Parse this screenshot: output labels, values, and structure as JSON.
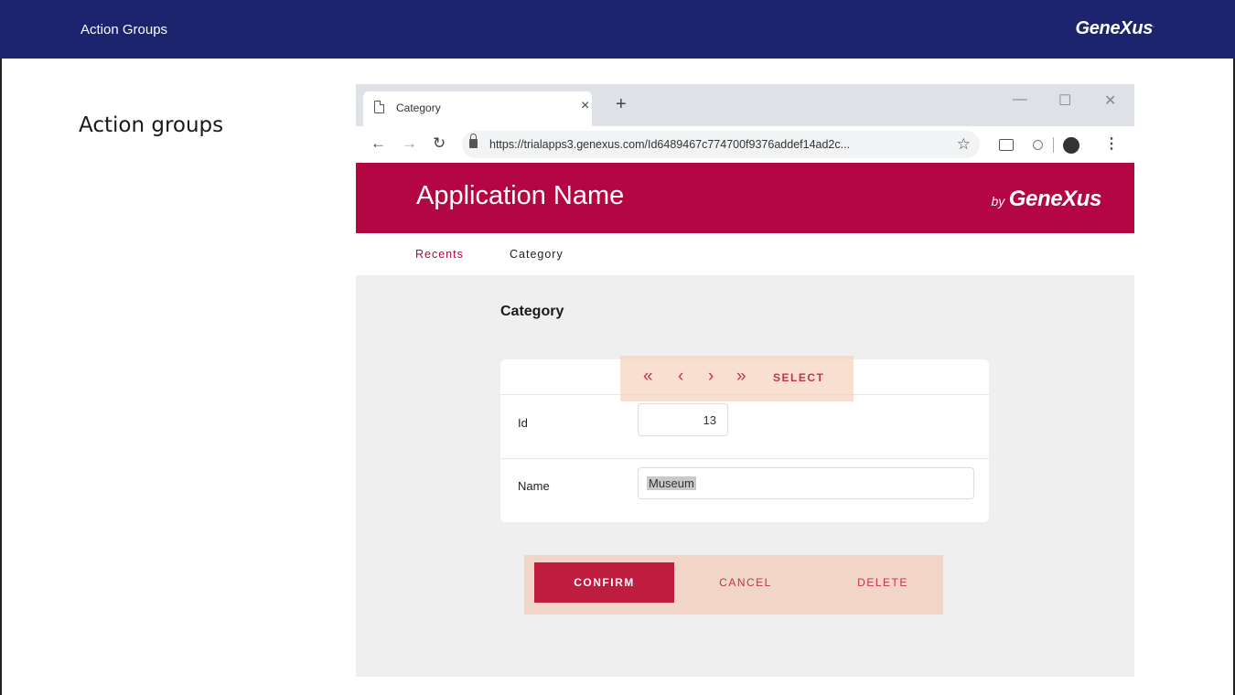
{
  "slide": {
    "section_title": "Action Groups",
    "brand": "GeneXus",
    "heading": "Action groups"
  },
  "browser": {
    "tab_title": "Category",
    "tab_close": "×",
    "new_tab": "+",
    "window_controls": {
      "minimize": "—",
      "maximize": "☐",
      "close": "✕"
    },
    "url": "https://trialapps3.genexus.com/Id6489467c774700f9376addef14ad2c...",
    "icons": [
      "page-icon",
      "back-icon",
      "forward-icon",
      "reload-icon",
      "lock-icon",
      "star-icon",
      "cast-icon",
      "extension-icon",
      "avatar",
      "menu-icon"
    ]
  },
  "app": {
    "title": "Application Name",
    "brand_by": "by",
    "brand_name": "GeneXus",
    "nav": {
      "recents": "Recents",
      "category": "Category"
    },
    "content_title": "Category",
    "navigation": {
      "first": "«",
      "previous": "‹",
      "next": "›",
      "last": "»",
      "select": "SELECT"
    },
    "fields": {
      "id_label": "Id",
      "id_value": "13",
      "name_label": "Name",
      "name_value": "Museum"
    },
    "actions": {
      "confirm": "CONFIRM",
      "cancel": "CANCEL",
      "delete": "DELETE"
    }
  },
  "colors": {
    "slide_header": "#1b246c",
    "app_header": "#b30642",
    "accent": "#c0334d",
    "confirm_button": "#bf1d3f",
    "highlight": "#f1d0be"
  }
}
